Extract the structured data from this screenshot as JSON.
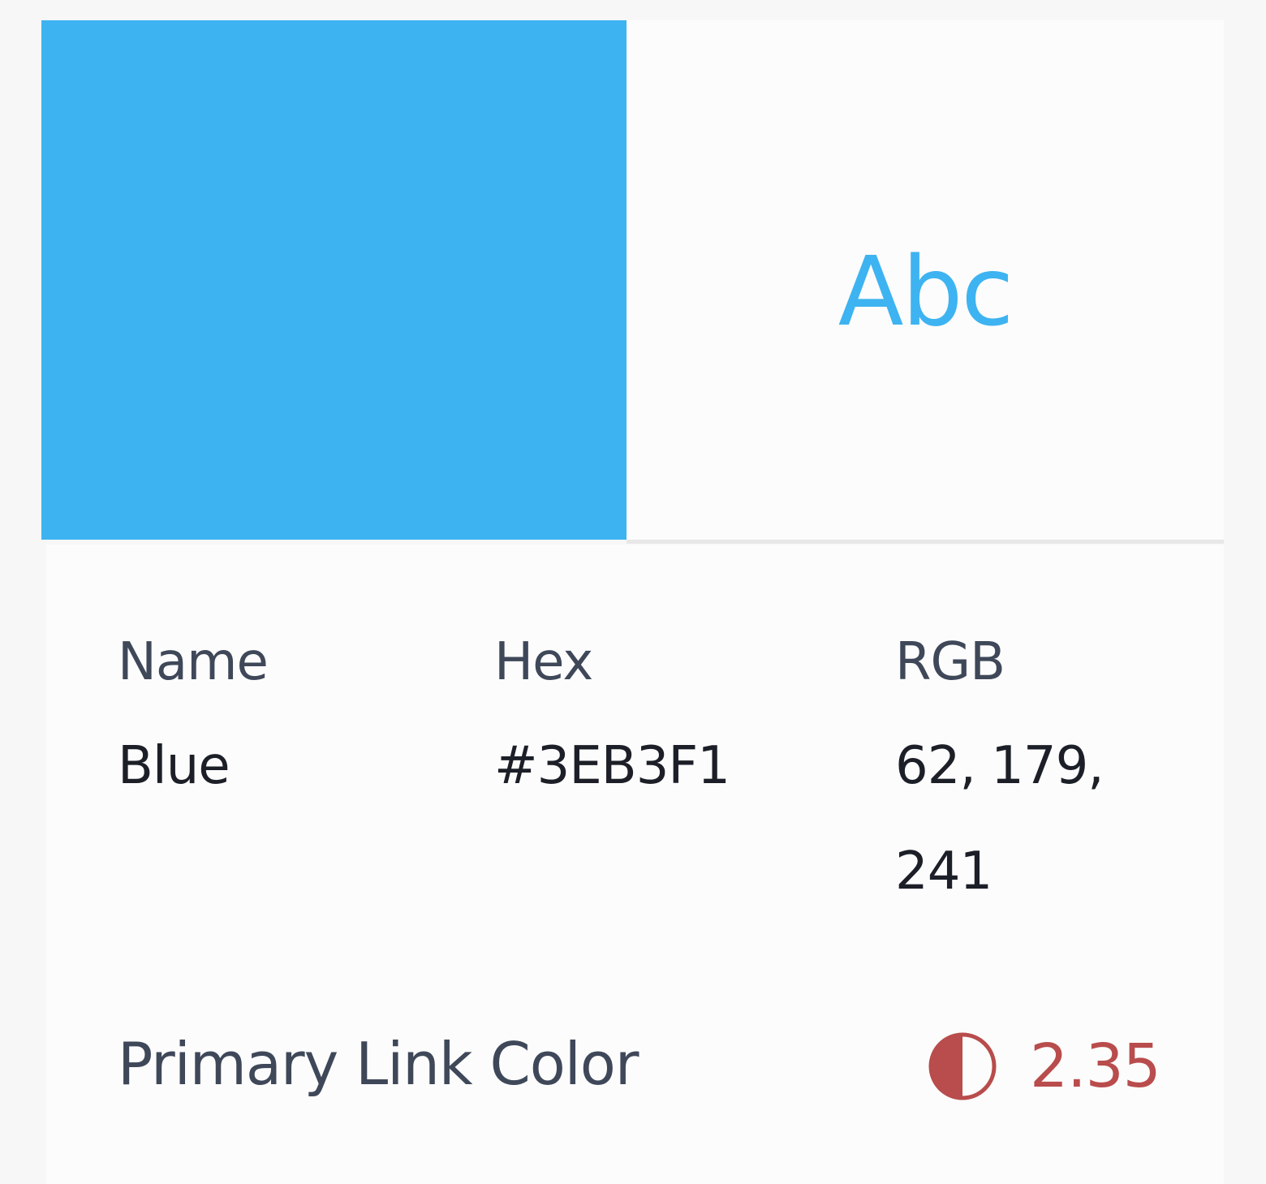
{
  "colors": {
    "swatch": "#3EB3F1",
    "sample_text": "#3EB3F1",
    "contrast_fail": "#B94C4C"
  },
  "preview": {
    "sample_text": "Abc"
  },
  "details": {
    "name_label": "Name",
    "name_value": "Blue",
    "hex_label": "Hex",
    "hex_value": "#3EB3F1",
    "rgb_label": "RGB",
    "rgb_value": "62, 179, 241"
  },
  "usage": {
    "label": "Primary Link Color"
  },
  "contrast": {
    "icon": "contrast-icon",
    "ratio": "2.35"
  }
}
